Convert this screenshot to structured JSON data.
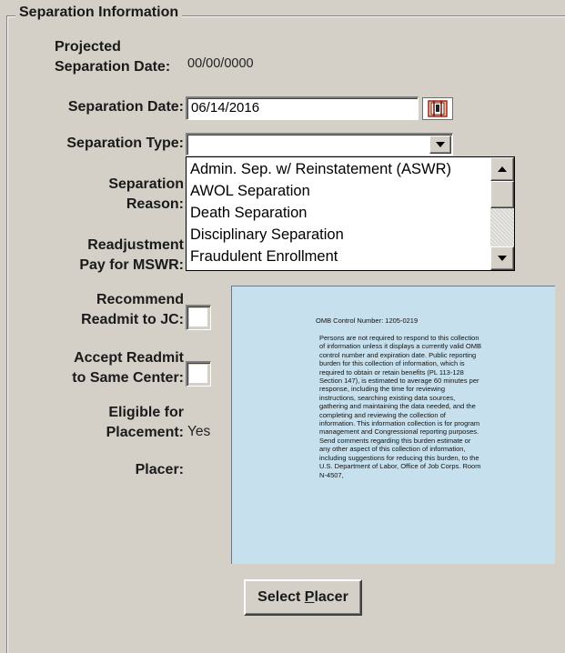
{
  "group": {
    "title": "Separation Information"
  },
  "fields": {
    "projected_label_1": "Projected",
    "projected_label_2": "Separation Date:",
    "projected_value": "00/00/0000",
    "sep_date_label": "Separation Date:",
    "sep_date_value": "06/14/2016",
    "sep_type_label": "Separation Type:",
    "sep_type_value": "",
    "sep_reason_label_1": "Separation",
    "sep_reason_label_2": "Reason:",
    "readj_label_1": "Readjustment",
    "readj_label_2": "Pay for MSWR:",
    "recommend_label_1": "Recommend",
    "recommend_label_2": "Readmit to JC:",
    "recommend_checked": false,
    "accept_label_1": "Accept Readmit",
    "accept_label_2": "to Same Center:",
    "accept_checked": false,
    "eligible_label_1": "Eligible for",
    "eligible_label_2": "Placement:",
    "eligible_value": "Yes",
    "placer_label": "Placer:"
  },
  "dropdown": {
    "options": [
      "Admin. Sep. w/ Reinstatement (ASWR)",
      "AWOL Separation",
      "Death Separation",
      "Disciplinary Separation",
      "Fraudulent Enrollment"
    ]
  },
  "omb": {
    "title": "OMB Control Number: 1205-0219",
    "body": " Persons are not required to respond to this collection of information unless it displays a currently valid OMB control number and expiration date. Public reporting burden for this collection of information, which is required to obtain or retain benefits (PL 113-128 Section 147), is estimated to average 60 minutes per response, including the time for reviewing instructions, searching existing data sources, gathering and maintaining the data needed, and the completing and reviewing the collection of information. This information collection is for program management and Congressional reporting purposes. Send comments regarding this burden estimate or any other aspect of this collection of information, including suggestions for reducing this burden, to the U.S. Department of Labor, Office of Job Corps. Room N-4507,"
  },
  "buttons": {
    "select_placer_prefix": "Select ",
    "select_placer_mnemonic": "P",
    "select_placer_suffix": "lacer"
  },
  "icons": {
    "calendar": "calendar-icon",
    "dropdown_arrow": "chevron-down-icon",
    "scroll_up": "arrow-up-icon",
    "scroll_down": "arrow-down-icon"
  }
}
